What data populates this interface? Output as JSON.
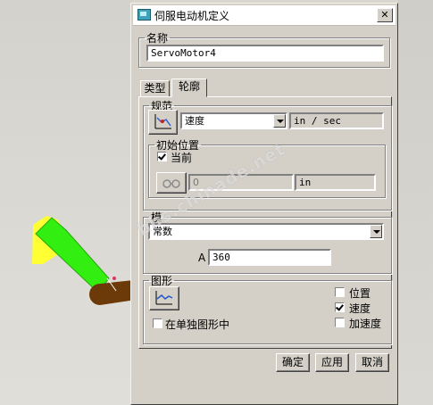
{
  "dialog": {
    "title": "伺服电动机定义",
    "close_glyph": "✕",
    "name_group": {
      "legend": "名称",
      "value": "ServoMotor4"
    },
    "tabs": [
      {
        "label": "类型"
      },
      {
        "label": "轮廓"
      }
    ],
    "spec": {
      "legend": "规范",
      "type_select": "速度",
      "unit": "in / sec",
      "initial_position": {
        "legend": "初始位置",
        "current_label": "当前",
        "current_checked": true,
        "value": "0",
        "unit": "in"
      }
    },
    "module": {
      "legend": "模",
      "select": "常数",
      "a_label": "A",
      "a_value": "360"
    },
    "graph": {
      "legend": "图形",
      "separate_label": "在单独图形中",
      "separate_checked": false,
      "options": [
        {
          "label": "位置",
          "checked": false
        },
        {
          "label": "速度",
          "checked": true
        },
        {
          "label": "加速度",
          "checked": false
        }
      ]
    },
    "buttons": {
      "ok": "确定",
      "apply": "应用",
      "cancel": "取消"
    }
  },
  "watermark": "bbs.chinade.net",
  "colors": {
    "dialog_bg": "#d4d0c8",
    "model_green": "#33ee11",
    "model_yellow": "#ffff33",
    "model_brown": "#6b3a08"
  }
}
